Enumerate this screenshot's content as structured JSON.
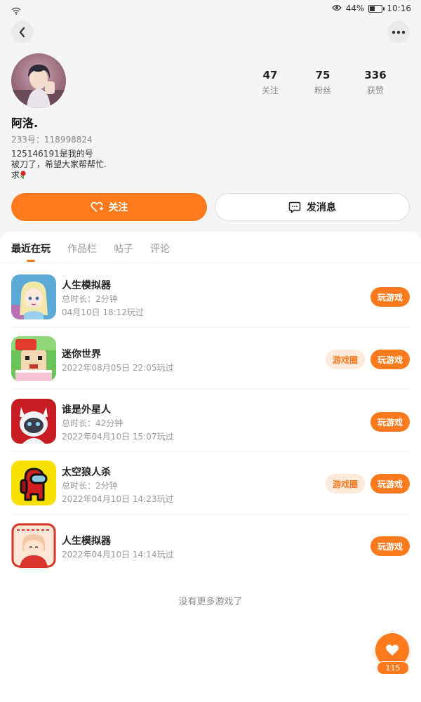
{
  "status": {
    "battery_text": "44%",
    "battery_level": 0.44,
    "time": "10:16"
  },
  "profile": {
    "username": "阿洛.",
    "uid": "233号：118998824",
    "bio_lines": [
      "125146191是我的号",
      "被刀了，希望大家帮帮忙.",
      "求"
    ],
    "stats": [
      {
        "value": "47",
        "label": "关注"
      },
      {
        "value": "75",
        "label": "粉丝"
      },
      {
        "value": "336",
        "label": "获赞"
      }
    ]
  },
  "actions": {
    "follow": "关注",
    "message": "发消息"
  },
  "tabs": [
    "最近在玩",
    "作品栏",
    "帖子",
    "评论"
  ],
  "games": [
    {
      "name": "人生模拟器",
      "duration": "总时长：2分钟",
      "played": "04月10日 18:12玩过",
      "play": "玩游戏",
      "circle": ""
    },
    {
      "name": "迷你世界",
      "duration": "",
      "played": "2022年08月05日 22:05玩过",
      "play": "玩游戏",
      "circle": "游戏圈"
    },
    {
      "name": "谁是外星人",
      "duration": "总时长：42分钟",
      "played": "2022年04月10日 15:07玩过",
      "play": "玩游戏",
      "circle": ""
    },
    {
      "name": "太空狼人杀",
      "duration": "总时长：2分钟",
      "played": "2022年04月10日 14:23玩过",
      "play": "玩游戏",
      "circle": "游戏圈"
    },
    {
      "name": "人生模拟器",
      "duration": "",
      "played": "2022年04月10日 14:14玩过",
      "play": "玩游戏",
      "circle": ""
    }
  ],
  "no_more": "没有更多游戏了",
  "likes": "115",
  "colors": {
    "accent": "#ff7a1c",
    "accent_light": "#ffeadc"
  }
}
